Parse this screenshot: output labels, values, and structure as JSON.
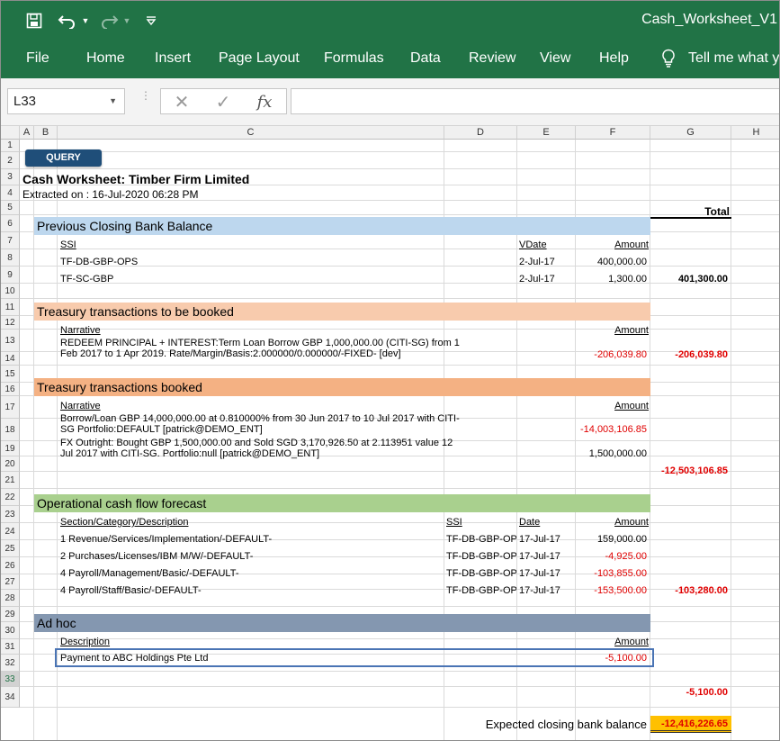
{
  "app": {
    "doc_title": "Cash_Worksheet_V1",
    "ribbon_tabs": [
      "File",
      "Home",
      "Insert",
      "Page Layout",
      "Formulas",
      "Data",
      "Review",
      "View",
      "Help"
    ],
    "tell_me": "Tell me what yo"
  },
  "formula_bar": {
    "name_box": "L33",
    "fx": "fx",
    "formula": ""
  },
  "columns": [
    "A",
    "B",
    "C",
    "D",
    "E",
    "F",
    "G",
    "H"
  ],
  "rows": [
    "1",
    "2",
    "3",
    "4",
    "5",
    "6",
    "7",
    "8",
    "9",
    "10",
    "11",
    "12",
    "13",
    "14",
    "15",
    "16",
    "17",
    "18",
    "19",
    "20",
    "21",
    "22",
    "23",
    "24",
    "25",
    "26",
    "27",
    "28",
    "29",
    "30",
    "31",
    "32",
    "33",
    "34"
  ],
  "sheet": {
    "query_button": "QUERY",
    "title": "Cash Worksheet: Timber Firm Limited",
    "extracted": "Extracted on : 16-Jul-2020 06:28 PM",
    "total_header": "Total",
    "sec_prev": {
      "title": "Previous Closing Bank Balance",
      "hdr_ssi": "SSI",
      "hdr_vdate": "VDate",
      "hdr_amount": "Amount",
      "rows": [
        {
          "ssi": "TF-DB-GBP-OPS",
          "date": "2-Jul-17",
          "amount": "400,000.00"
        },
        {
          "ssi": "TF-SC-GBP",
          "date": "2-Jul-17",
          "amount": "1,300.00"
        }
      ],
      "total": "401,300.00"
    },
    "sec_to_book": {
      "title": "Treasury transactions to be booked",
      "hdr_narrative": "Narrative",
      "hdr_amount": "Amount",
      "row_line1": "REDEEM PRINCIPAL + INTEREST:Term Loan Borrow GBP 1,000,000.00 (CITI-SG) from 1",
      "row_line2": "Feb 2017 to 1 Apr 2019. Rate/Margin/Basis:2.000000/0.000000/-FIXED- [dev]",
      "row_amount": "-206,039.80",
      "total": "-206,039.80"
    },
    "sec_booked": {
      "title": "Treasury transactions booked",
      "hdr_narrative": "Narrative",
      "hdr_amount": "Amount",
      "row1_line1": "Borrow/Loan GBP 14,000,000.00 at 0.810000% from 30 Jun 2017 to 10 Jul 2017 with CITI-",
      "row1_line2": "SG  Portfolio:DEFAULT [patrick@DEMO_ENT]",
      "row1_amount": "-14,003,106.85",
      "row2_line1": "FX Outright: Bought GBP 1,500,000.00 and Sold SGD 3,170,926.50 at 2.113951 value 12",
      "row2_line2": "Jul 2017 with CITI-SG. Portfolio:null [patrick@DEMO_ENT]",
      "row2_amount": "1,500,000.00",
      "total": "-12,503,106.85"
    },
    "sec_ops": {
      "title": "Operational cash flow forecast",
      "hdr_section": "Section/Category/Description",
      "hdr_ssi": "SSI",
      "hdr_date": "Date",
      "hdr_amount": "Amount",
      "rows": [
        {
          "desc": "1 Revenue/Services/Implementation/-DEFAULT-",
          "ssi": "TF-DB-GBP-OPS",
          "date": "17-Jul-17",
          "amount": "159,000.00"
        },
        {
          "desc": "2 Purchases/Licenses/IBM M/W/-DEFAULT-",
          "ssi": "TF-DB-GBP-OPS",
          "date": "17-Jul-17",
          "amount": "-4,925.00"
        },
        {
          "desc": "4 Payroll/Management/Basic/-DEFAULT-",
          "ssi": "TF-DB-GBP-OPS",
          "date": "17-Jul-17",
          "amount": "-103,855.00"
        },
        {
          "desc": "4 Payroll/Staff/Basic/-DEFAULT-",
          "ssi": "TF-DB-GBP-OPS",
          "date": "17-Jul-17",
          "amount": "-153,500.00"
        }
      ],
      "total": "-103,280.00"
    },
    "sec_adhoc": {
      "title": "Ad hoc",
      "hdr_description": "Description",
      "hdr_amount": "Amount",
      "row_desc": "Payment to ABC Holdings Pte Ltd",
      "row_amount": "-5,100.00",
      "total": "-5,100.00"
    },
    "closing_label": "Expected closing bank balance",
    "closing_value": "-12,416,226.65"
  },
  "colors": {
    "excel_green": "#217346",
    "band_prev": "#bdd7ee",
    "band_to_book": "#f8cbad",
    "band_booked": "#f4b183",
    "band_ops": "#a9d08e",
    "band_adhoc": "#8497b0",
    "highlight": "#ffc000",
    "negative": "#e00000"
  }
}
